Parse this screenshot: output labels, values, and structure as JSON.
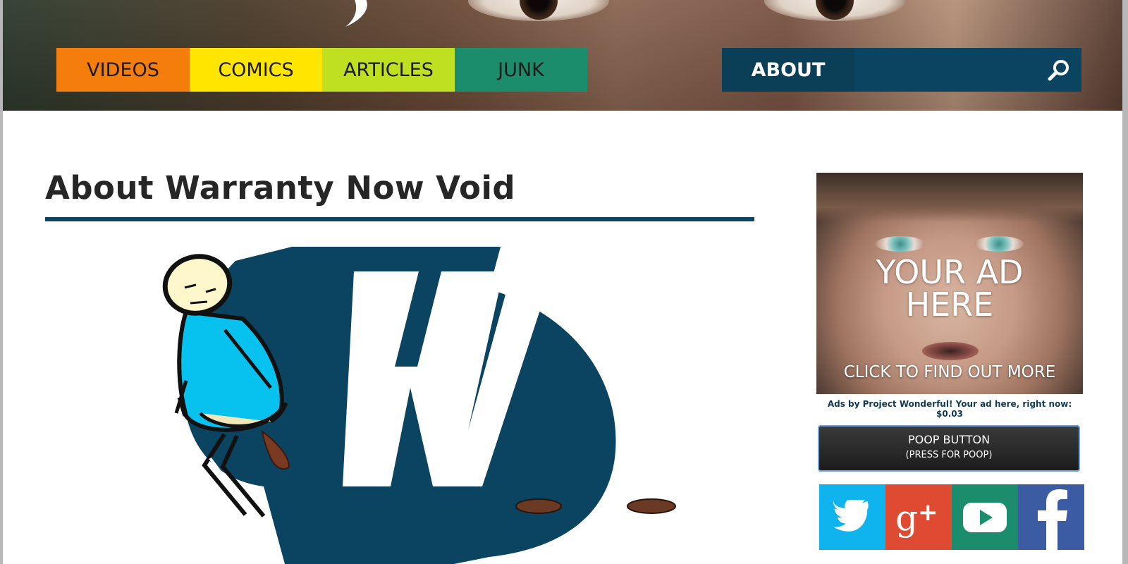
{
  "nav": {
    "videos": "VIDEOS",
    "comics": "COMICS",
    "articles": "ARTICLES",
    "junk": "JUNK",
    "about": "ABOUT"
  },
  "main": {
    "title": "About Warranty Now Void"
  },
  "sidebar": {
    "ad": {
      "headline_line1": "YOUR AD",
      "headline_line2": "HERE",
      "cta": "CLICK TO FIND OUT MORE",
      "note": "Ads by Project Wonderful! Your ad here, right now: $0.03"
    },
    "poop_button": {
      "line1": "POOP BUTTON",
      "line2": "(PRESS FOR POOP)"
    },
    "social": [
      "twitter-icon",
      "google-plus-icon",
      "youtube-icon",
      "facebook-icon"
    ]
  },
  "colors": {
    "videos": "#f47d0c",
    "comics": "#ffe500",
    "articles": "#bfe021",
    "junk": "#1b8c6c",
    "brand_dark": "#0a4460",
    "twitter": "#0fb4ee",
    "google_plus": "#df4a32",
    "youtube": "#1b8c6c",
    "facebook": "#3b5ca3"
  }
}
